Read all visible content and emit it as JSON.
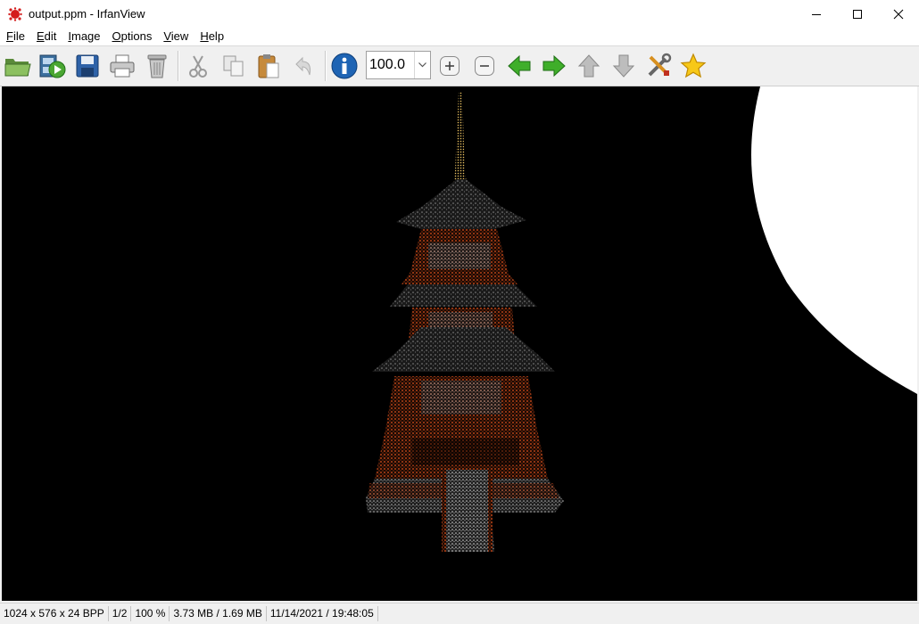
{
  "window": {
    "title": "output.ppm - IrfanView",
    "app_icon": "irfanview-cat-icon",
    "controls": [
      "minimize-icon",
      "maximize-icon",
      "close-icon"
    ]
  },
  "menu": {
    "items": [
      {
        "label": "File",
        "accel": "F",
        "rest": "ile"
      },
      {
        "label": "Edit",
        "accel": "E",
        "rest": "dit"
      },
      {
        "label": "Image",
        "accel": "I",
        "rest": "mage"
      },
      {
        "label": "Options",
        "accel": "O",
        "rest": "ptions"
      },
      {
        "label": "View",
        "accel": "V",
        "rest": "iew"
      },
      {
        "label": "Help",
        "accel": "H",
        "rest": "elp"
      }
    ]
  },
  "toolbar": {
    "icons": [
      "open-folder-icon",
      "slideshow-icon",
      "save-icon",
      "print-icon",
      "delete-icon",
      "cut-icon",
      "copy-icon",
      "paste-icon",
      "undo-icon",
      "info-icon",
      "zoom-in-icon",
      "zoom-out-icon",
      "previous-icon",
      "next-icon",
      "up-icon",
      "down-icon",
      "properties-icon",
      "favorite-icon"
    ],
    "zoom_value": "100.0"
  },
  "status": {
    "dimensions": "1024 x 576 x 24 BPP",
    "page": "1/2",
    "zoom": "100 %",
    "size": "3.73 MB / 1.69 MB",
    "datetime": "11/14/2021 / 19:48:05"
  },
  "colors": {
    "canvas": "#000000",
    "orange": "#e0521c",
    "gold": "#e8c060",
    "gray": "#8a8a8a"
  }
}
